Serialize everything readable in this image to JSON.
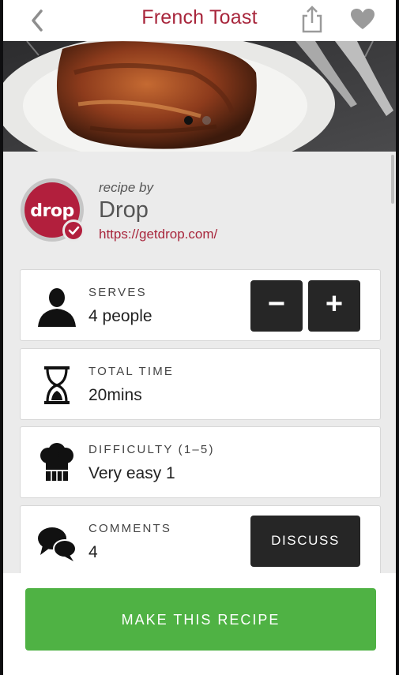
{
  "header": {
    "title": "French Toast",
    "back_icon": "back-chevron-icon",
    "share_icon": "share-icon",
    "favorite_icon": "heart-icon"
  },
  "hero": {
    "image_subject": "stack of french toast on white plate with forks",
    "carousel": {
      "current_index": 1,
      "total": 2
    }
  },
  "author": {
    "prefix": "recipe by",
    "name": "Drop",
    "url": "https://getdrop.com/",
    "logo_text": "drop",
    "verified_icon": "check-badge-icon"
  },
  "details": [
    {
      "id": "serves",
      "icon": "person-icon",
      "label": "SERVES",
      "value": "4 people",
      "decrement_label": "−",
      "increment_label": "+"
    },
    {
      "id": "total-time",
      "icon": "hourglass-icon",
      "label": "TOTAL TIME",
      "value": "20mins"
    },
    {
      "id": "difficulty",
      "icon": "chef-hat-icon",
      "label": "DIFFICULTY (1–5)",
      "value": "Very easy 1"
    },
    {
      "id": "comments",
      "icon": "chat-bubbles-icon",
      "label": "COMMENTS",
      "value": "4",
      "action_label": "DISCUSS"
    }
  ],
  "footer": {
    "primary_action": "MAKE THIS RECIPE"
  },
  "colors": {
    "accent": "#a8263c",
    "brand_red": "#b21f3d",
    "primary_green": "#4fb244",
    "dark_button": "#262626",
    "background": "#ebebeb"
  }
}
